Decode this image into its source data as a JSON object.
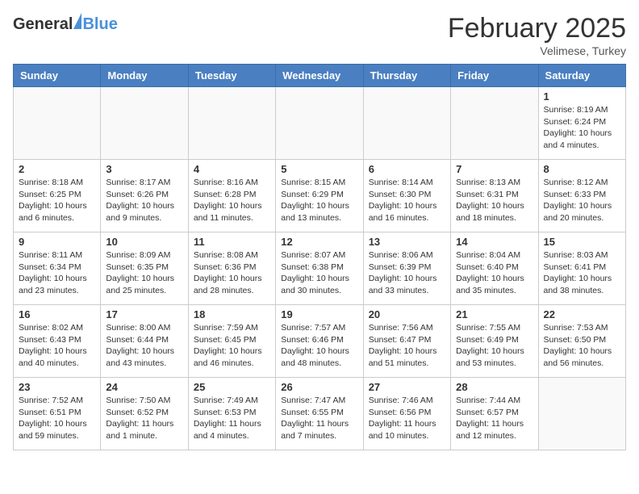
{
  "header": {
    "logo_general": "General",
    "logo_blue": "Blue",
    "month": "February 2025",
    "location": "Velimese, Turkey"
  },
  "weekdays": [
    "Sunday",
    "Monday",
    "Tuesday",
    "Wednesday",
    "Thursday",
    "Friday",
    "Saturday"
  ],
  "weeks": [
    [
      {
        "day": "",
        "info": ""
      },
      {
        "day": "",
        "info": ""
      },
      {
        "day": "",
        "info": ""
      },
      {
        "day": "",
        "info": ""
      },
      {
        "day": "",
        "info": ""
      },
      {
        "day": "",
        "info": ""
      },
      {
        "day": "1",
        "info": "Sunrise: 8:19 AM\nSunset: 6:24 PM\nDaylight: 10 hours\nand 4 minutes."
      }
    ],
    [
      {
        "day": "2",
        "info": "Sunrise: 8:18 AM\nSunset: 6:25 PM\nDaylight: 10 hours\nand 6 minutes."
      },
      {
        "day": "3",
        "info": "Sunrise: 8:17 AM\nSunset: 6:26 PM\nDaylight: 10 hours\nand 9 minutes."
      },
      {
        "day": "4",
        "info": "Sunrise: 8:16 AM\nSunset: 6:28 PM\nDaylight: 10 hours\nand 11 minutes."
      },
      {
        "day": "5",
        "info": "Sunrise: 8:15 AM\nSunset: 6:29 PM\nDaylight: 10 hours\nand 13 minutes."
      },
      {
        "day": "6",
        "info": "Sunrise: 8:14 AM\nSunset: 6:30 PM\nDaylight: 10 hours\nand 16 minutes."
      },
      {
        "day": "7",
        "info": "Sunrise: 8:13 AM\nSunset: 6:31 PM\nDaylight: 10 hours\nand 18 minutes."
      },
      {
        "day": "8",
        "info": "Sunrise: 8:12 AM\nSunset: 6:33 PM\nDaylight: 10 hours\nand 20 minutes."
      }
    ],
    [
      {
        "day": "9",
        "info": "Sunrise: 8:11 AM\nSunset: 6:34 PM\nDaylight: 10 hours\nand 23 minutes."
      },
      {
        "day": "10",
        "info": "Sunrise: 8:09 AM\nSunset: 6:35 PM\nDaylight: 10 hours\nand 25 minutes."
      },
      {
        "day": "11",
        "info": "Sunrise: 8:08 AM\nSunset: 6:36 PM\nDaylight: 10 hours\nand 28 minutes."
      },
      {
        "day": "12",
        "info": "Sunrise: 8:07 AM\nSunset: 6:38 PM\nDaylight: 10 hours\nand 30 minutes."
      },
      {
        "day": "13",
        "info": "Sunrise: 8:06 AM\nSunset: 6:39 PM\nDaylight: 10 hours\nand 33 minutes."
      },
      {
        "day": "14",
        "info": "Sunrise: 8:04 AM\nSunset: 6:40 PM\nDaylight: 10 hours\nand 35 minutes."
      },
      {
        "day": "15",
        "info": "Sunrise: 8:03 AM\nSunset: 6:41 PM\nDaylight: 10 hours\nand 38 minutes."
      }
    ],
    [
      {
        "day": "16",
        "info": "Sunrise: 8:02 AM\nSunset: 6:43 PM\nDaylight: 10 hours\nand 40 minutes."
      },
      {
        "day": "17",
        "info": "Sunrise: 8:00 AM\nSunset: 6:44 PM\nDaylight: 10 hours\nand 43 minutes."
      },
      {
        "day": "18",
        "info": "Sunrise: 7:59 AM\nSunset: 6:45 PM\nDaylight: 10 hours\nand 46 minutes."
      },
      {
        "day": "19",
        "info": "Sunrise: 7:57 AM\nSunset: 6:46 PM\nDaylight: 10 hours\nand 48 minutes."
      },
      {
        "day": "20",
        "info": "Sunrise: 7:56 AM\nSunset: 6:47 PM\nDaylight: 10 hours\nand 51 minutes."
      },
      {
        "day": "21",
        "info": "Sunrise: 7:55 AM\nSunset: 6:49 PM\nDaylight: 10 hours\nand 53 minutes."
      },
      {
        "day": "22",
        "info": "Sunrise: 7:53 AM\nSunset: 6:50 PM\nDaylight: 10 hours\nand 56 minutes."
      }
    ],
    [
      {
        "day": "23",
        "info": "Sunrise: 7:52 AM\nSunset: 6:51 PM\nDaylight: 10 hours\nand 59 minutes."
      },
      {
        "day": "24",
        "info": "Sunrise: 7:50 AM\nSunset: 6:52 PM\nDaylight: 11 hours\nand 1 minute."
      },
      {
        "day": "25",
        "info": "Sunrise: 7:49 AM\nSunset: 6:53 PM\nDaylight: 11 hours\nand 4 minutes."
      },
      {
        "day": "26",
        "info": "Sunrise: 7:47 AM\nSunset: 6:55 PM\nDaylight: 11 hours\nand 7 minutes."
      },
      {
        "day": "27",
        "info": "Sunrise: 7:46 AM\nSunset: 6:56 PM\nDaylight: 11 hours\nand 10 minutes."
      },
      {
        "day": "28",
        "info": "Sunrise: 7:44 AM\nSunset: 6:57 PM\nDaylight: 11 hours\nand 12 minutes."
      },
      {
        "day": "",
        "info": ""
      }
    ]
  ]
}
